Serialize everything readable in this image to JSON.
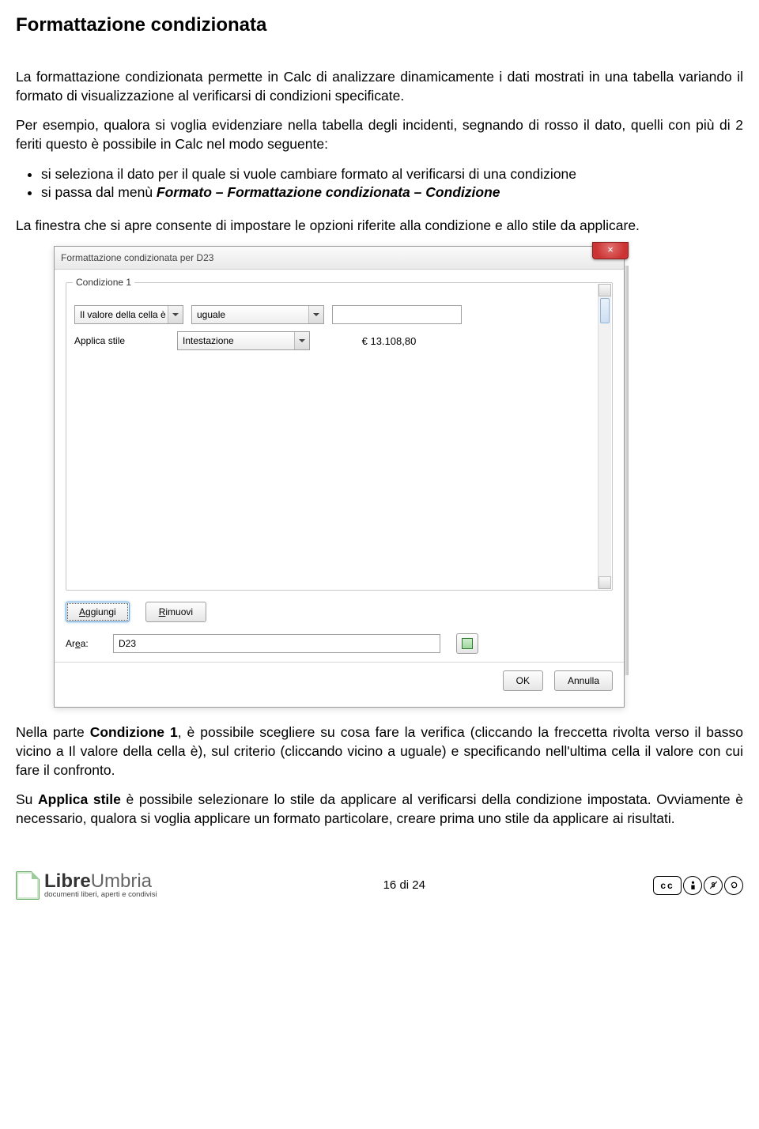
{
  "title": "Formattazione condizionata",
  "p1": "La formattazione condizionata permette in Calc di analizzare dinamicamente i dati mostrati in una tabella variando il formato di visualizzazione al verificarsi di condizioni specificate.",
  "p2": "Per esempio, qualora si voglia evidenziare nella tabella degli incidenti, segnando di rosso il dato, quelli con più di 2 feriti questo è possibile in Calc nel modo seguente:",
  "bullet1": "si seleziona il dato per il quale si vuole cambiare formato al verificarsi di una condizione",
  "bullet2a": "si passa dal menù ",
  "bullet2b": "Formato – Formattazione condizionata – Condizione",
  "p3": "La finestra che si apre consente di impostare le opzioni riferite alla condizione e allo stile da applicare.",
  "dialog": {
    "title": "Formattazione condizionata per D23",
    "close": "×",
    "group": "Condizione 1",
    "row1label": "Il valore della cella è",
    "row1combo": "uguale",
    "row1value": "",
    "row2label": "Applica stile",
    "row2combo": "Intestazione",
    "preview": "€ 13.108,80",
    "addbtn": "Aggiungi",
    "removebtn": "Rimuovi",
    "arealabel": "Area:",
    "areavalue": "D23",
    "ok": "OK",
    "cancel": "Annulla"
  },
  "p4a": "Nella parte ",
  "p4b": "Condizione 1",
  "p4c": ", è possibile scegliere su cosa fare la verifica (cliccando la freccetta rivolta verso il basso vicino a Il valore della cella è), sul criterio (cliccando vicino a uguale) e specificando nell'ultima cella il valore con cui fare il confronto.",
  "p5a": "Su ",
  "p5b": "Applica stile",
  "p5c": "  è possibile selezionare lo stile da applicare al verificarsi della condizione impostata. Ovviamente è necessario, qualora si voglia applicare un formato particolare, creare prima uno stile da applicare ai risultati.",
  "footer": {
    "logo1": "Libre",
    "logo2": "Umbria",
    "tagline": "documenti liberi, aperti e condivisi",
    "pagenum": "16 di 24",
    "cc": "cc"
  }
}
